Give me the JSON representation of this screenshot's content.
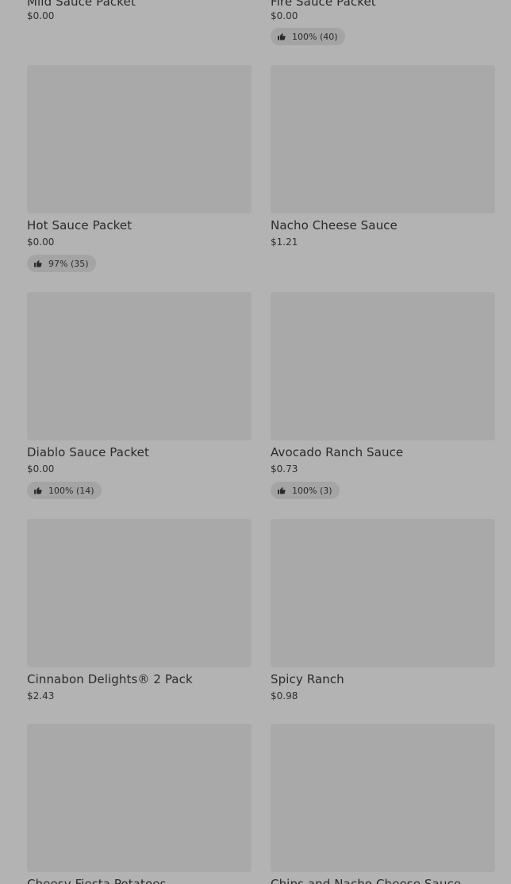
{
  "products": [
    {
      "name": "Mild Sauce Packet",
      "price": "$0.00",
      "rating": ""
    },
    {
      "name": "Fire Sauce Packet",
      "price": "$0.00",
      "rating": "100% (40)"
    },
    {
      "name": "Hot Sauce Packet",
      "price": "$0.00",
      "rating": "97% (35)"
    },
    {
      "name": "Nacho Cheese Sauce",
      "price": "$1.21",
      "rating": ""
    },
    {
      "name": "Diablo Sauce Packet",
      "price": "$0.00",
      "rating": "100% (14)"
    },
    {
      "name": "Avocado Ranch Sauce",
      "price": "$0.73",
      "rating": "100% (3)"
    },
    {
      "name": "Cinnabon Delights® 2 Pack",
      "price": "$2.43",
      "rating": ""
    },
    {
      "name": "Spicy Ranch",
      "price": "$0.98",
      "rating": ""
    },
    {
      "name": "Cheesy Fiesta Potatoes",
      "price": "",
      "rating": ""
    },
    {
      "name": "Chips and Nacho Cheese Sauce",
      "price": "",
      "rating": ""
    }
  ],
  "icons": {
    "rating": "thumbs-up-icon"
  }
}
